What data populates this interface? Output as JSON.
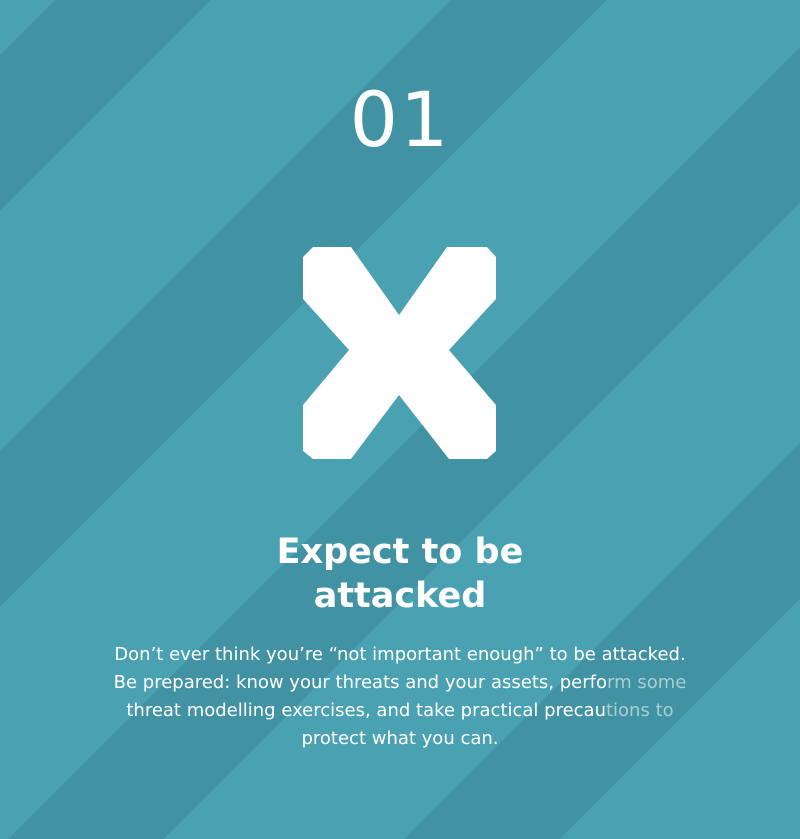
{
  "card": {
    "number": "01",
    "icon": "x-cross-icon",
    "title_line1": "Expect to be",
    "title_line2": "attacked",
    "body_line1": "Don’t ever think you’re “not important enough” to be attacked.",
    "body_line2a": "Be prepared: know your threats and your assets, perfo",
    "body_line2b": "rm some",
    "body_line3a": "threat modelling exercises, and take practical precau",
    "body_line3b": "tions to",
    "body_line4": "protect what you can."
  },
  "colors": {
    "stripe_light": "#4aa1b2",
    "stripe_dark": "#4192a2",
    "text": "#ffffff"
  }
}
